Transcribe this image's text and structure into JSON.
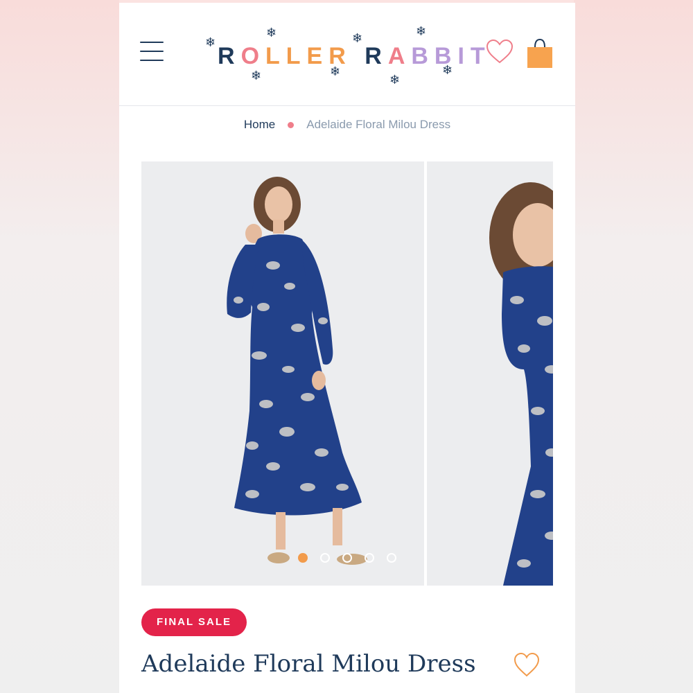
{
  "header": {
    "logo_text_parts": [
      "R",
      "O",
      "LLER",
      " ",
      "R",
      "A",
      "BBIT"
    ],
    "menu_icon": "hamburger-menu-icon",
    "wishlist_icon": "heart-outline-icon",
    "cart_icon": "shopping-bag-icon"
  },
  "breadcrumb": {
    "home": "Home",
    "current": "Adelaide Floral Milou Dress"
  },
  "gallery": {
    "slide_count": 5,
    "active_index": 0,
    "active_dot_color": "#f29b4b",
    "dress_color": "#22418a"
  },
  "product": {
    "badge": "FINAL SALE",
    "title": "Adelaide Floral Milou Dress",
    "wishlist_icon": "heart-outline-icon"
  },
  "colors": {
    "navy": "#1f3a5a",
    "accent_orange": "#f29b4b",
    "sale_red": "#e3234a",
    "pink": "#ef7e8a",
    "lavender": "#b79ad8"
  }
}
